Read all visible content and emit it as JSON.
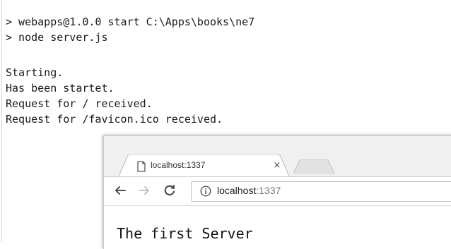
{
  "console": {
    "lines": [
      "> webapps@1.0.0 start C:\\Apps\\books\\ne7",
      "> node server.js",
      "Starting.",
      "Has been startet.",
      "Request for / received.",
      "Request for /favicon.ico received."
    ]
  },
  "browser": {
    "tab": {
      "title": "localhost:1337",
      "close_glyph": "×",
      "icon": "page-icon"
    },
    "toolbar": {
      "back_icon": "arrow-left-icon",
      "forward_icon": "arrow-right-icon",
      "reload_icon": "reload-icon",
      "url_host": "localhost",
      "url_port": ":1337",
      "info_icon": "info-icon"
    },
    "page": {
      "content": "The first Server"
    }
  }
}
